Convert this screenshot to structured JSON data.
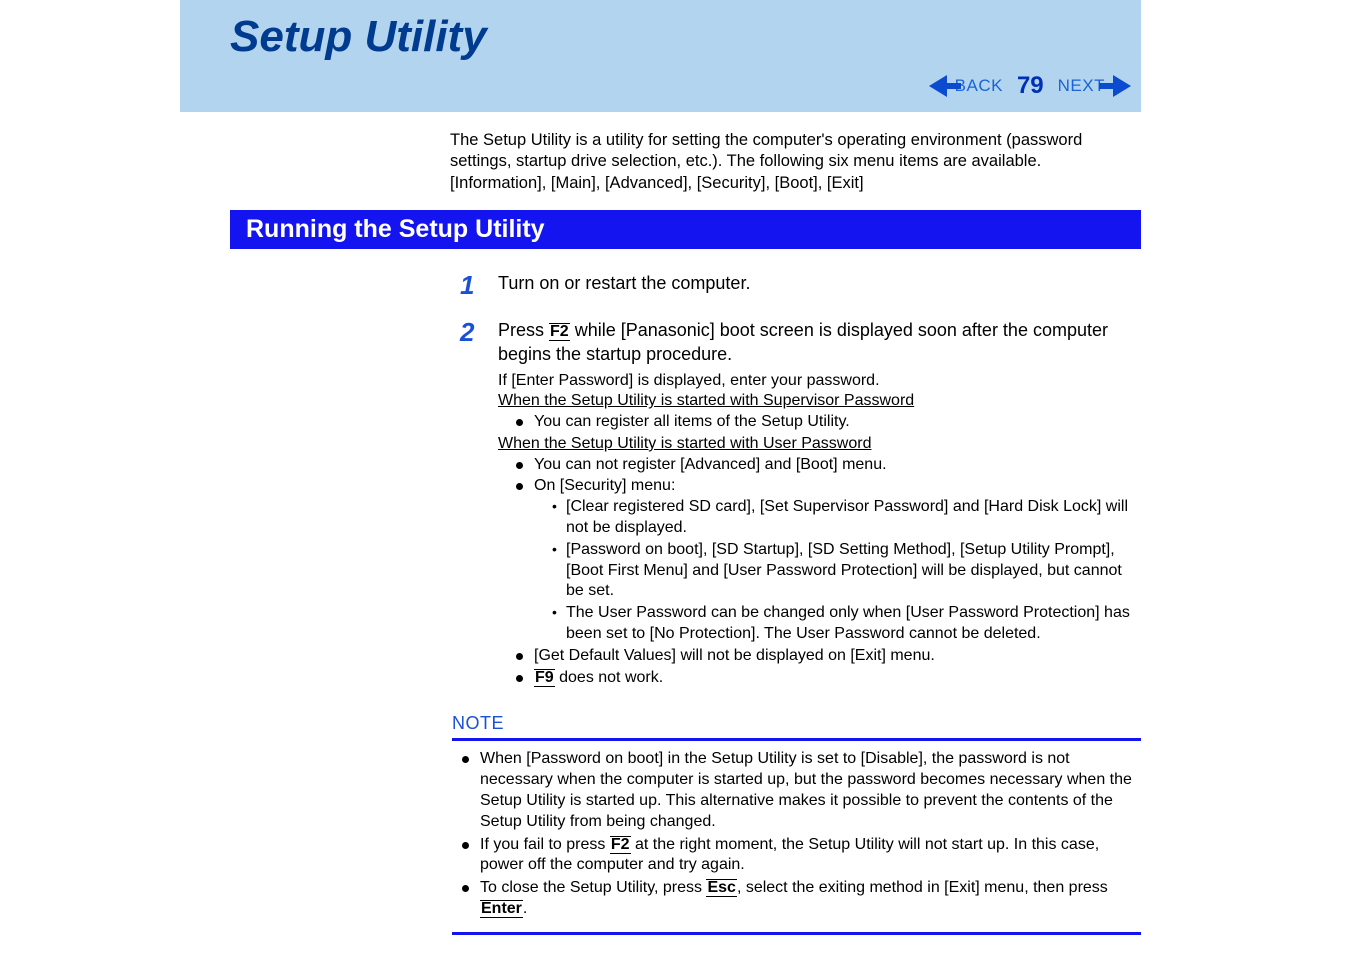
{
  "header": {
    "title": "Setup Utility",
    "nav": {
      "back": "BACK",
      "page": "79",
      "next": "NEXT"
    }
  },
  "intro": {
    "line1": "The Setup Utility is a utility for setting the computer's operating environment (password settings, startup drive selection, etc.). The following six menu items are available.",
    "line2": "[Information], [Main], [Advanced], [Security], [Boot], [Exit]"
  },
  "section": {
    "title": "Running the Setup Utility"
  },
  "steps": {
    "s1": {
      "num": "1",
      "text": "Turn on or restart the computer."
    },
    "s2": {
      "num": "2",
      "prefix": "Press ",
      "key1": "F2",
      "mid": " while [Panasonic] boot screen is displayed soon after the computer begins the startup procedure.",
      "sub1": "If [Enter Password] is displayed, enter your password.",
      "u1": "When the Setup Utility is started with Supervisor Password",
      "b1": "You can register all items of the Setup Utility.",
      "u2": "When the Setup Utility is started with User Password",
      "b2": "You can not register [Advanced] and [Boot] menu.",
      "b3": "On [Security] menu:",
      "sb1": "[Clear registered SD card], [Set Supervisor Password] and [Hard Disk Lock] will not be displayed.",
      "sb2": "[Password on boot], [SD Startup], [SD Setting Method], [Setup Utility Prompt], [Boot First Menu] and [User Password Protection] will be displayed, but cannot be set.",
      "sb3": "The User Password can be changed only when [User Password Protection] has been set to [No Protection].  The User Password cannot be deleted.",
      "b4": "[Get Default Values] will not be displayed on [Exit] menu.",
      "key2": "F9",
      "b5": " does not work."
    }
  },
  "note": {
    "label": "NOTE",
    "n1": "When [Password on boot] in the Setup Utility is set to [Disable], the password is not necessary when the computer is started up, but the password becomes necessary when the Setup Utility is started up.  This alternative makes it possible to prevent the contents of the Setup Utility from being changed.",
    "n2a": "If you fail to press ",
    "n2key": "F2",
    "n2b": " at the right moment, the Setup Utility will not start up. In this case, power off the computer and try again.",
    "n3a": "To close the Setup Utility, press ",
    "n3key1": "Esc",
    "n3b": ", select the exiting method in [Exit] menu, then press ",
    "n3key2": "Enter",
    "n3c": "."
  }
}
